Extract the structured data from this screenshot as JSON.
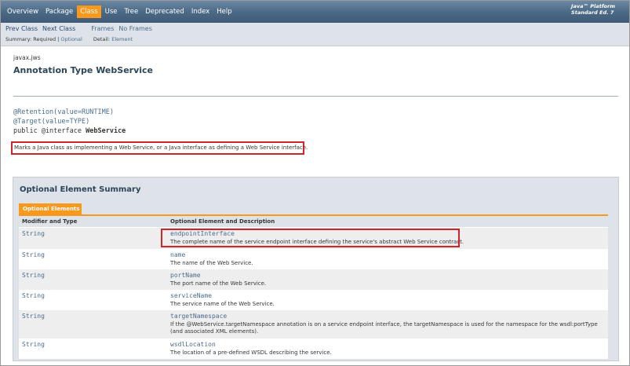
{
  "topnav": {
    "items": [
      {
        "label": "Overview",
        "active": false
      },
      {
        "label": "Package",
        "active": false
      },
      {
        "label": "Class",
        "active": true
      },
      {
        "label": "Use",
        "active": false
      },
      {
        "label": "Tree",
        "active": false
      },
      {
        "label": "Deprecated",
        "active": false
      },
      {
        "label": "Index",
        "active": false
      },
      {
        "label": "Help",
        "active": false
      }
    ],
    "brand_line1": "Java™ Platform",
    "brand_line2": "Standard Ed. 7"
  },
  "subnav": {
    "prev_class": "Prev Class",
    "next_class": "Next Class",
    "frames": "Frames",
    "no_frames": "No Frames",
    "summary_label": "Summary:",
    "summary_required": "Required",
    "summary_sep": "|",
    "summary_optional": "Optional",
    "detail_label": "Detail:",
    "detail_element": "Element"
  },
  "header": {
    "package": "javax.jws",
    "title": "Annotation Type WebService"
  },
  "signature": {
    "retention": "@Retention(value=RUNTIME)",
    "target": "@Target(value=TYPE)",
    "decl_prefix": "public @interface ",
    "decl_name": "WebService"
  },
  "description": "Marks a Java class as implementing a Web Service, or a Java interface as defining a Web Service interface.",
  "summary": {
    "title": "Optional Element Summary",
    "tab_label": "Optional Elements",
    "col_type": "Modifier and Type",
    "col_desc": "Optional Element and Description",
    "rows": [
      {
        "type": "String",
        "name": "endpointInterface",
        "desc": "The complete name of the service endpoint interface defining the service's abstract Web Service contract."
      },
      {
        "type": "String",
        "name": "name",
        "desc": "The name of the Web Service."
      },
      {
        "type": "String",
        "name": "portName",
        "desc": "The port name of the Web Service."
      },
      {
        "type": "String",
        "name": "serviceName",
        "desc": "The service name of the Web Service."
      },
      {
        "type": "String",
        "name": "targetNamespace",
        "desc": "If the @WebService.targetNamespace annotation is on a service endpoint interface, the targetNamespace is used for the namespace for the wsdl:portType (and associated XML elements)."
      },
      {
        "type": "String",
        "name": "wsdlLocation",
        "desc": "The location of a pre-defined WSDL describing the service."
      }
    ]
  },
  "colors": {
    "nav_bg": "#4a6784",
    "active_tab": "#f8981d",
    "highlight": "#d2232a",
    "link": "#4a6d8c"
  }
}
